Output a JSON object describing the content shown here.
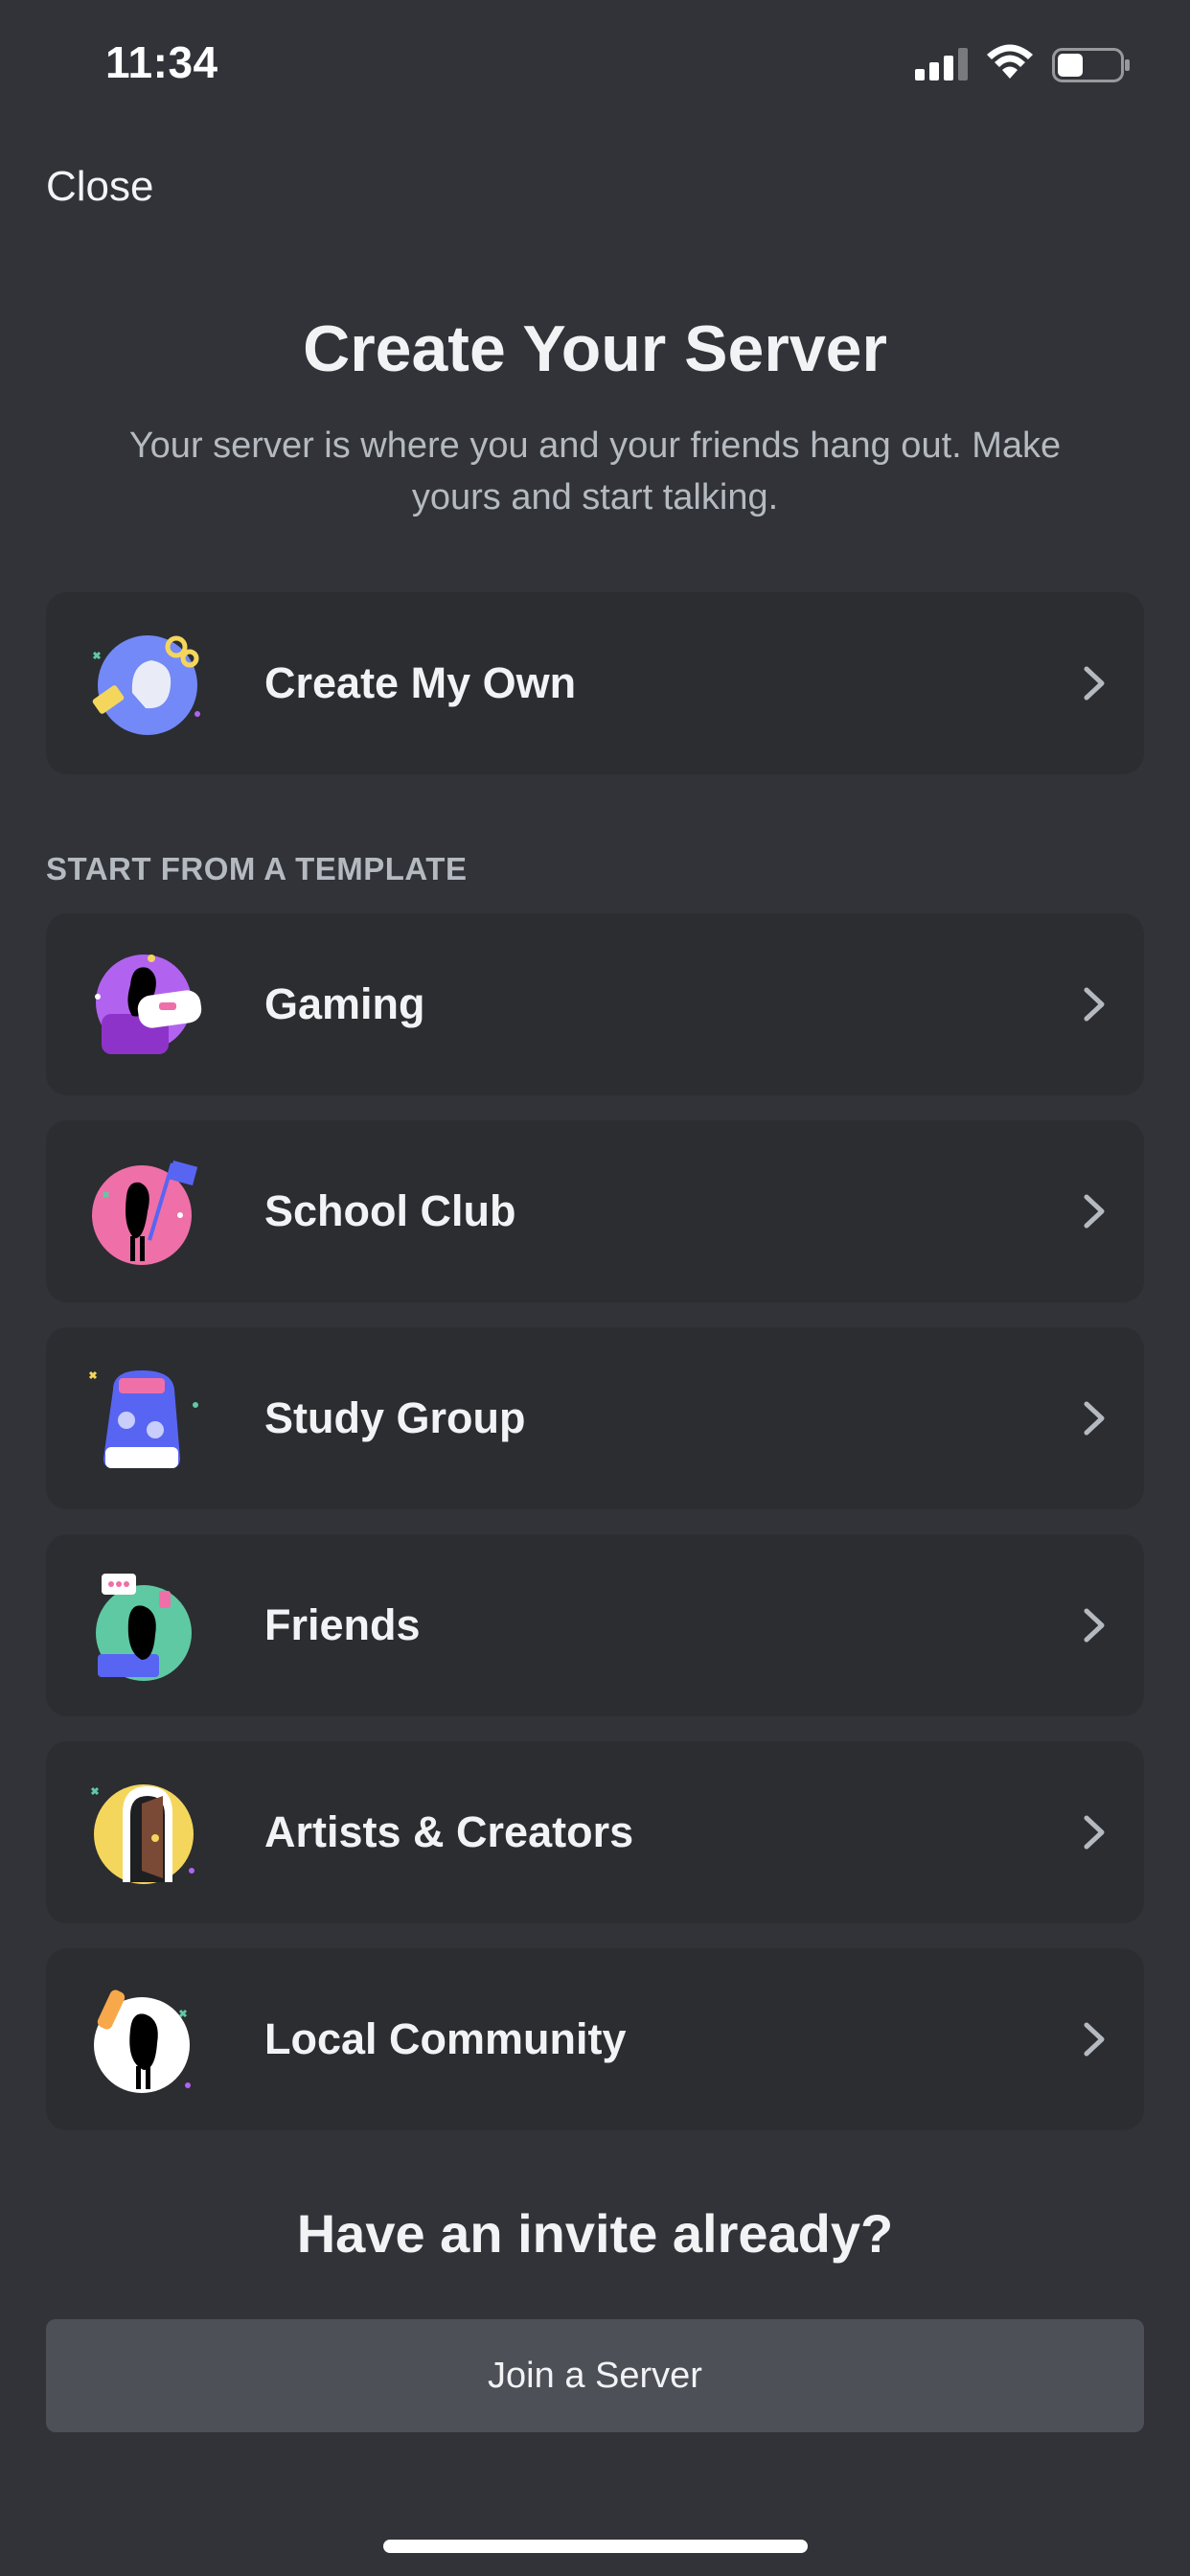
{
  "status_bar": {
    "time": "11:34"
  },
  "nav": {
    "close_label": "Close"
  },
  "header": {
    "title": "Create Your Server",
    "subtitle": "Your server is where you and your friends hang out. Make yours and start talking."
  },
  "create_own": {
    "label": "Create My Own",
    "icon": "create-server-illustration"
  },
  "templates": {
    "section_label": "START FROM A TEMPLATE",
    "items": [
      {
        "label": "Gaming",
        "icon": "gaming-illustration",
        "accent": "#b163f0"
      },
      {
        "label": "School Club",
        "icon": "school-club-illustration",
        "accent": "#ef6fa8"
      },
      {
        "label": "Study Group",
        "icon": "study-group-illustration",
        "accent": "#5865f2"
      },
      {
        "label": "Friends",
        "icon": "friends-illustration",
        "accent": "#5fc9a3"
      },
      {
        "label": "Artists & Creators",
        "icon": "artists-creators-illustration",
        "accent": "#f4d65c"
      },
      {
        "label": "Local Community",
        "icon": "local-community-illustration",
        "accent": "#ffffff"
      }
    ]
  },
  "invite": {
    "heading": "Have an invite already?",
    "join_button_label": "Join a Server"
  },
  "colors": {
    "background": "#313338",
    "card": "#2b2d31",
    "button": "#4e5058",
    "muted_text": "#b5bac1"
  }
}
